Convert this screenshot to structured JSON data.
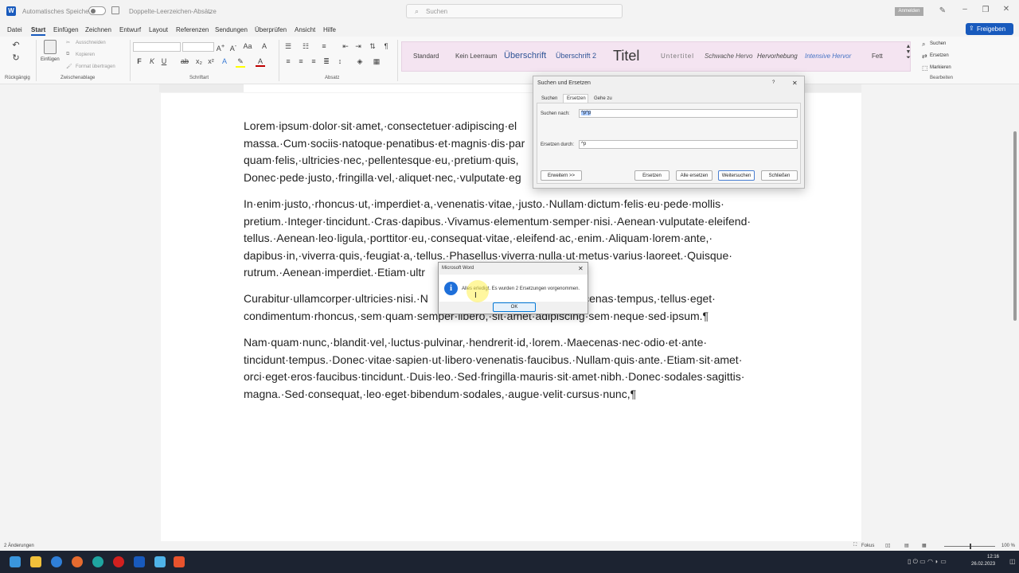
{
  "titlebar": {
    "autosave_label": "Automatisches Speichern",
    "doc_title": "Doppelte-Leerzeichen-Absätze",
    "search_placeholder": "Suchen",
    "signin_label": "Anmelden"
  },
  "menu": {
    "tabs": [
      "Datei",
      "Start",
      "Einfügen",
      "Zeichnen",
      "Entwurf",
      "Layout",
      "Referenzen",
      "Sendungen",
      "Überprüfen",
      "Ansicht",
      "Hilfe"
    ],
    "active_index": 1,
    "share_label": "Freigeben"
  },
  "ribbon": {
    "undo_label": "Rückgängig",
    "paste_label": "Einfügen",
    "cut_label": "Ausschneiden",
    "copy_label": "Kopieren",
    "format_painter_label": "Format übertragen",
    "clipboard_label": "Zwischenablage",
    "font_label": "Schriftart",
    "paragraph_label": "Absatz",
    "styles": [
      "Standard",
      "Kein Leerraum",
      "Überschrift",
      "Überschrift 2",
      "Titel",
      "Untertitel",
      "Schwache Hervo",
      "Hervorhebung",
      "Intensive Hervor",
      "Fett"
    ],
    "find_label": "Suchen",
    "replace_label": "Ersetzen",
    "select_label": "Markieren",
    "edit_label": "Bearbeiten",
    "bold": "F",
    "italic": "K",
    "underline": "U"
  },
  "document": {
    "paragraphs": [
      "Lorem·ipsum·dolor·sit·amet,·consectetuer·adipiscing·el\nmassa.·Cum·sociis·natoque·penatibus·et·magnis·dis·par\nquam·felis,·ultricies·nec,·pellentesque·eu,·pretium·quis,\nDonec·pede·justo,·fringilla·vel,·aliquet·nec,·vulputate·eg",
      "In·enim·justo,·rhoncus·ut,·imperdiet·a,·venenatis·vitae,·justo.·Nullam·dictum·felis·eu·pede·mollis·\npretium.·Integer·tincidunt.·Cras·dapibus.·Vivamus·elementum·semper·nisi.·Aenean·vulputate·eleifend·\ntellus.·Aenean·leo·ligula,·porttitor·eu,·consequat·vitae,·eleifend·ac,·enim.·Aliquam·lorem·ante,·\ndapibus·in,·viverra·quis,·feugiat·a,·tellus.·Phasellus·viverra·nulla·ut·metus·varius·laoreet.·Quisque·\nrutrum.·Aenean·imperdiet.·Etiam·ultr",
      "Curabitur·ullamcorper·ultricies·nisi.·N                                          ·Maecenas·tempus,·tellus·eget·\ncondimentum·rhoncus,·sem·quam·semper·libero,·sit·amet·adipiscing·sem·neque·sed·ipsum.¶",
      "Nam·quam·nunc,·blandit·vel,·luctus·pulvinar,·hendrerit·id,·lorem.·Maecenas·nec·odio·et·ante·\ntincidunt·tempus.·Donec·vitae·sapien·ut·libero·venenatis·faucibus.·Nullam·quis·ante.·Etiam·sit·amet·\norci·eget·eros·faucibus·tincidunt.·Duis·leo.·Sed·fringilla·mauris·sit·amet·nibh.·Donec·sodales·sagittis·\nmagna.·Sed·consequat,·leo·eget·bibendum·sodales,·augue·velit·cursus·nunc,¶"
    ]
  },
  "find_replace": {
    "title": "Suchen und Ersetzen",
    "help": "?",
    "tabs": [
      "Suchen",
      "Ersetzen",
      "Gehe zu"
    ],
    "active_tab": 1,
    "find_label": "Suchen nach:",
    "find_value": "^p^p",
    "replace_label": "Ersetzen durch:",
    "replace_value": "^p",
    "more_button": "Erweitern >>",
    "replace_button": "Ersetzen",
    "replace_all_button": "Alle ersetzen",
    "find_next_button": "Weitersuchen",
    "close_button": "Schließen"
  },
  "msgbox": {
    "title": "Microsoft Word",
    "message": "Alles erledigt. Es wurden 2 Ersetzungen vorgenommen.",
    "ok_button": "OK"
  },
  "status": {
    "changes": "2 Änderungen",
    "focus": "Fokus",
    "zoom": "100 %",
    "time": "12:16",
    "date": "26.02.2023"
  },
  "colors": {
    "accent": "#185abd",
    "styles_bg": "#f4e4f1",
    "taskbar": "#1c2331",
    "font_color_underline": "#c00000",
    "highlight_underline": "#ffff00"
  }
}
